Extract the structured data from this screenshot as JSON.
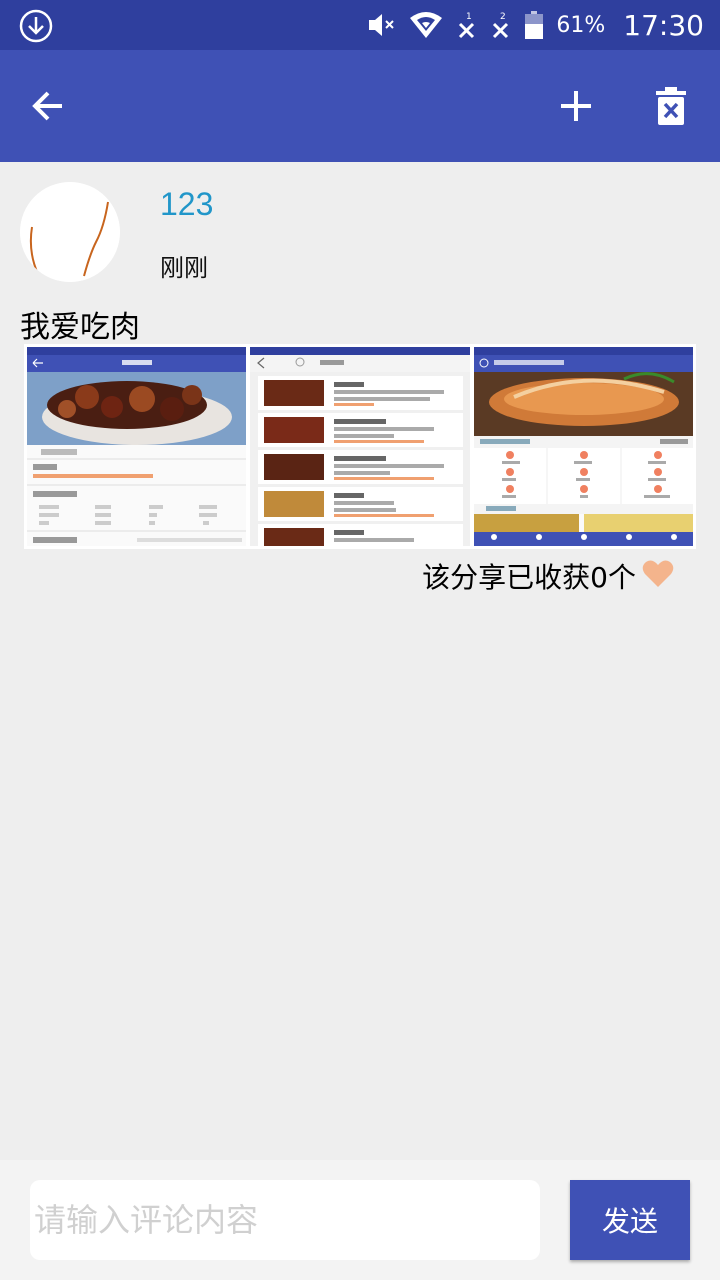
{
  "status_bar": {
    "battery_percent": "61%",
    "time": "17:30",
    "icons": [
      "download-icon",
      "mute-icon",
      "wifi-icon",
      "signal-1-icon",
      "signal-2-icon",
      "battery-icon"
    ]
  },
  "toolbar": {
    "icons": [
      "back-arrow-icon",
      "plus-icon",
      "trash-icon"
    ]
  },
  "post": {
    "username": "123",
    "timestamp": "刚刚",
    "content": "我爱吃肉",
    "images": [
      {
        "name": "screenshot-recipe-detail"
      },
      {
        "name": "screenshot-recipe-list"
      },
      {
        "name": "screenshot-app-home"
      }
    ],
    "collect_text": "该分享已收获0个"
  },
  "comment": {
    "placeholder": "请输入评论内容",
    "value": "",
    "send_label": "发送"
  },
  "colors": {
    "primary": "#3f51b5",
    "primary_dark": "#2f3f9e",
    "username": "#2196c9",
    "heart": "#f4b48c"
  }
}
